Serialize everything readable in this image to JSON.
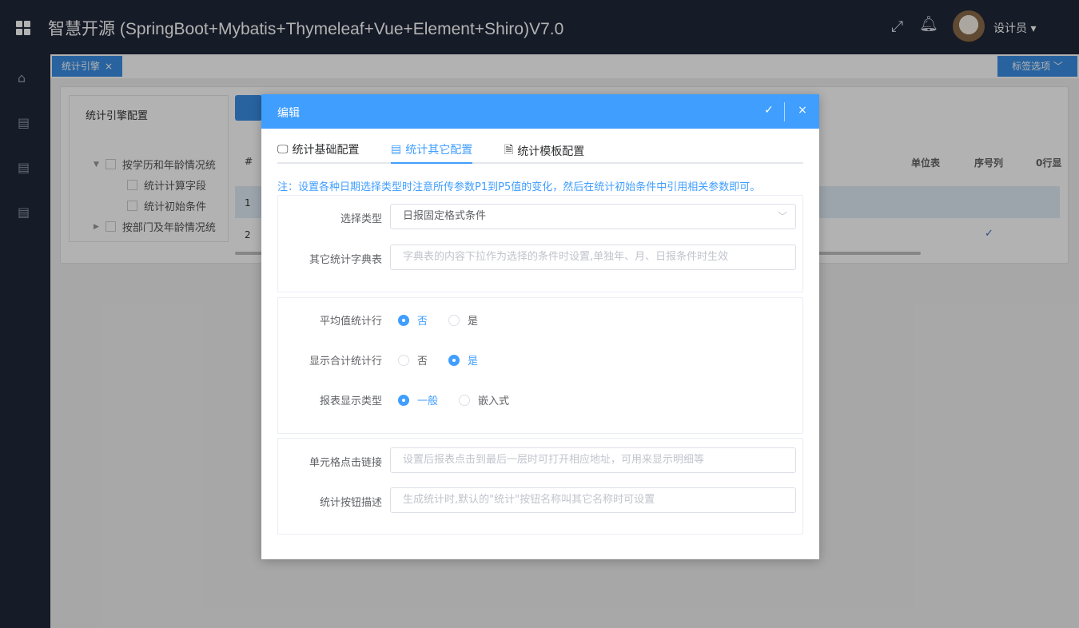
{
  "app": {
    "title": "智慧开源 (SpringBoot+Mybatis+Thymeleaf+Vue+Element+Shiro)V7.0",
    "user": "设计员 ▾"
  },
  "tabs_bar": {
    "active_tab": "统计引擎",
    "close": "×",
    "options": "标签选项 ﹀"
  },
  "tree": {
    "title": "统计引擎配置",
    "items": [
      {
        "label": "按学历和年龄情况统"
      },
      {
        "label": "统计计算字段"
      },
      {
        "label": "统计初始条件"
      },
      {
        "label": "按部门及年龄情况统"
      }
    ]
  },
  "table": {
    "headers": [
      "#",
      "单位表",
      "序号列",
      "0行显"
    ],
    "rows": [
      "1",
      "2"
    ],
    "check": "✓"
  },
  "dialog": {
    "title": "编辑",
    "tabs": [
      "统计基础配置",
      "统计其它配置",
      "统计模板配置"
    ],
    "note": "注：设置各种日期选择类型时注意所传参数P1到P5值的变化，然后在统计初始条件中引用相关参数即可。",
    "select_type": {
      "label": "选择类型",
      "value": "日报固定格式条件"
    },
    "dict_table": {
      "label": "其它统计字典表",
      "placeholder": "字典表的内容下拉作为选择的条件时设置,单独年、月、日报条件时生效"
    },
    "avg_row": {
      "label": "平均值统计行",
      "options": [
        "否",
        "是"
      ],
      "selected": "否"
    },
    "total_row": {
      "label": "显示合计统计行",
      "options": [
        "否",
        "是"
      ],
      "selected": "是"
    },
    "report_type": {
      "label": "报表显示类型",
      "options": [
        "一般",
        "嵌入式"
      ],
      "selected": "一般"
    },
    "cell_link": {
      "label": "单元格点击链接",
      "placeholder": "设置后报表点击到最后一层时可打开相应地址，可用来显示明细等"
    },
    "btn_desc": {
      "label": "统计按钮描述",
      "placeholder": "生成统计时,默认的\"统计\"按钮名称叫其它名称时可设置"
    }
  },
  "colors": {
    "topbar": "#1f2838",
    "accent": "#409eff"
  },
  "icons": [
    "grid-icon",
    "fullscreen-icon",
    "bell-icon",
    "home-icon",
    "doc-icon",
    "monitor-icon",
    "calendar-icon",
    "file-icon",
    "check-icon",
    "close-icon",
    "chevron-down-icon"
  ]
}
